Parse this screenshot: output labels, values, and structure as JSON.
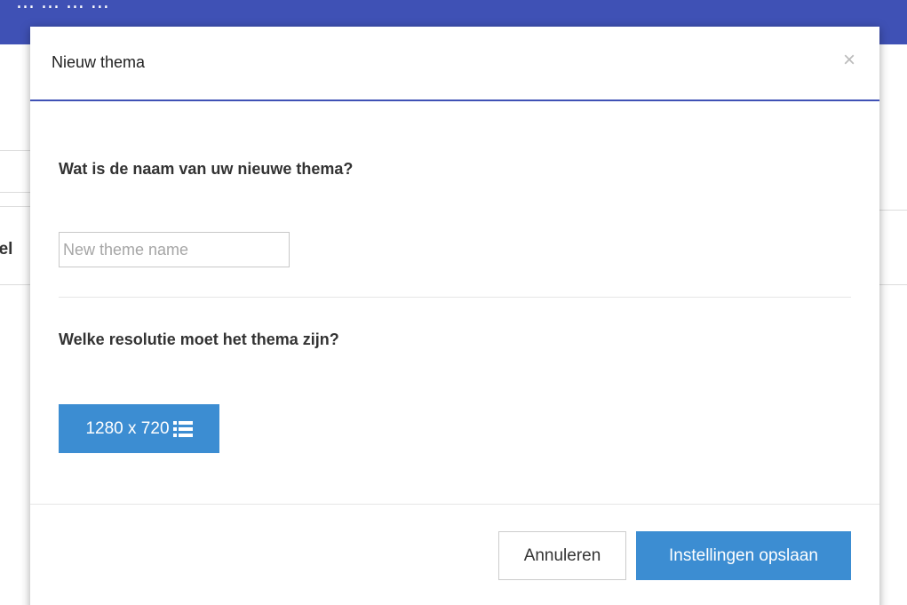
{
  "background": {
    "top_text": "... ... ... ...",
    "partial_label": "eel"
  },
  "modal": {
    "title": "Nieuw thema",
    "close_glyph": "×",
    "name_question": "Wat is de naam van uw nieuwe thema?",
    "name_input": {
      "value": "",
      "placeholder": "New theme name"
    },
    "resolution_question": "Welke resolutie moet het thema zijn?",
    "resolution_button_label": "1280 x 720",
    "resolution_button_icon": "list-icon",
    "cancel_label": "Annuleren",
    "save_label": "Instellingen opslaan"
  },
  "colors": {
    "topbar": "#3f51b5",
    "header_rule": "#3f51b5",
    "primary_button": "#3c8dd2"
  }
}
